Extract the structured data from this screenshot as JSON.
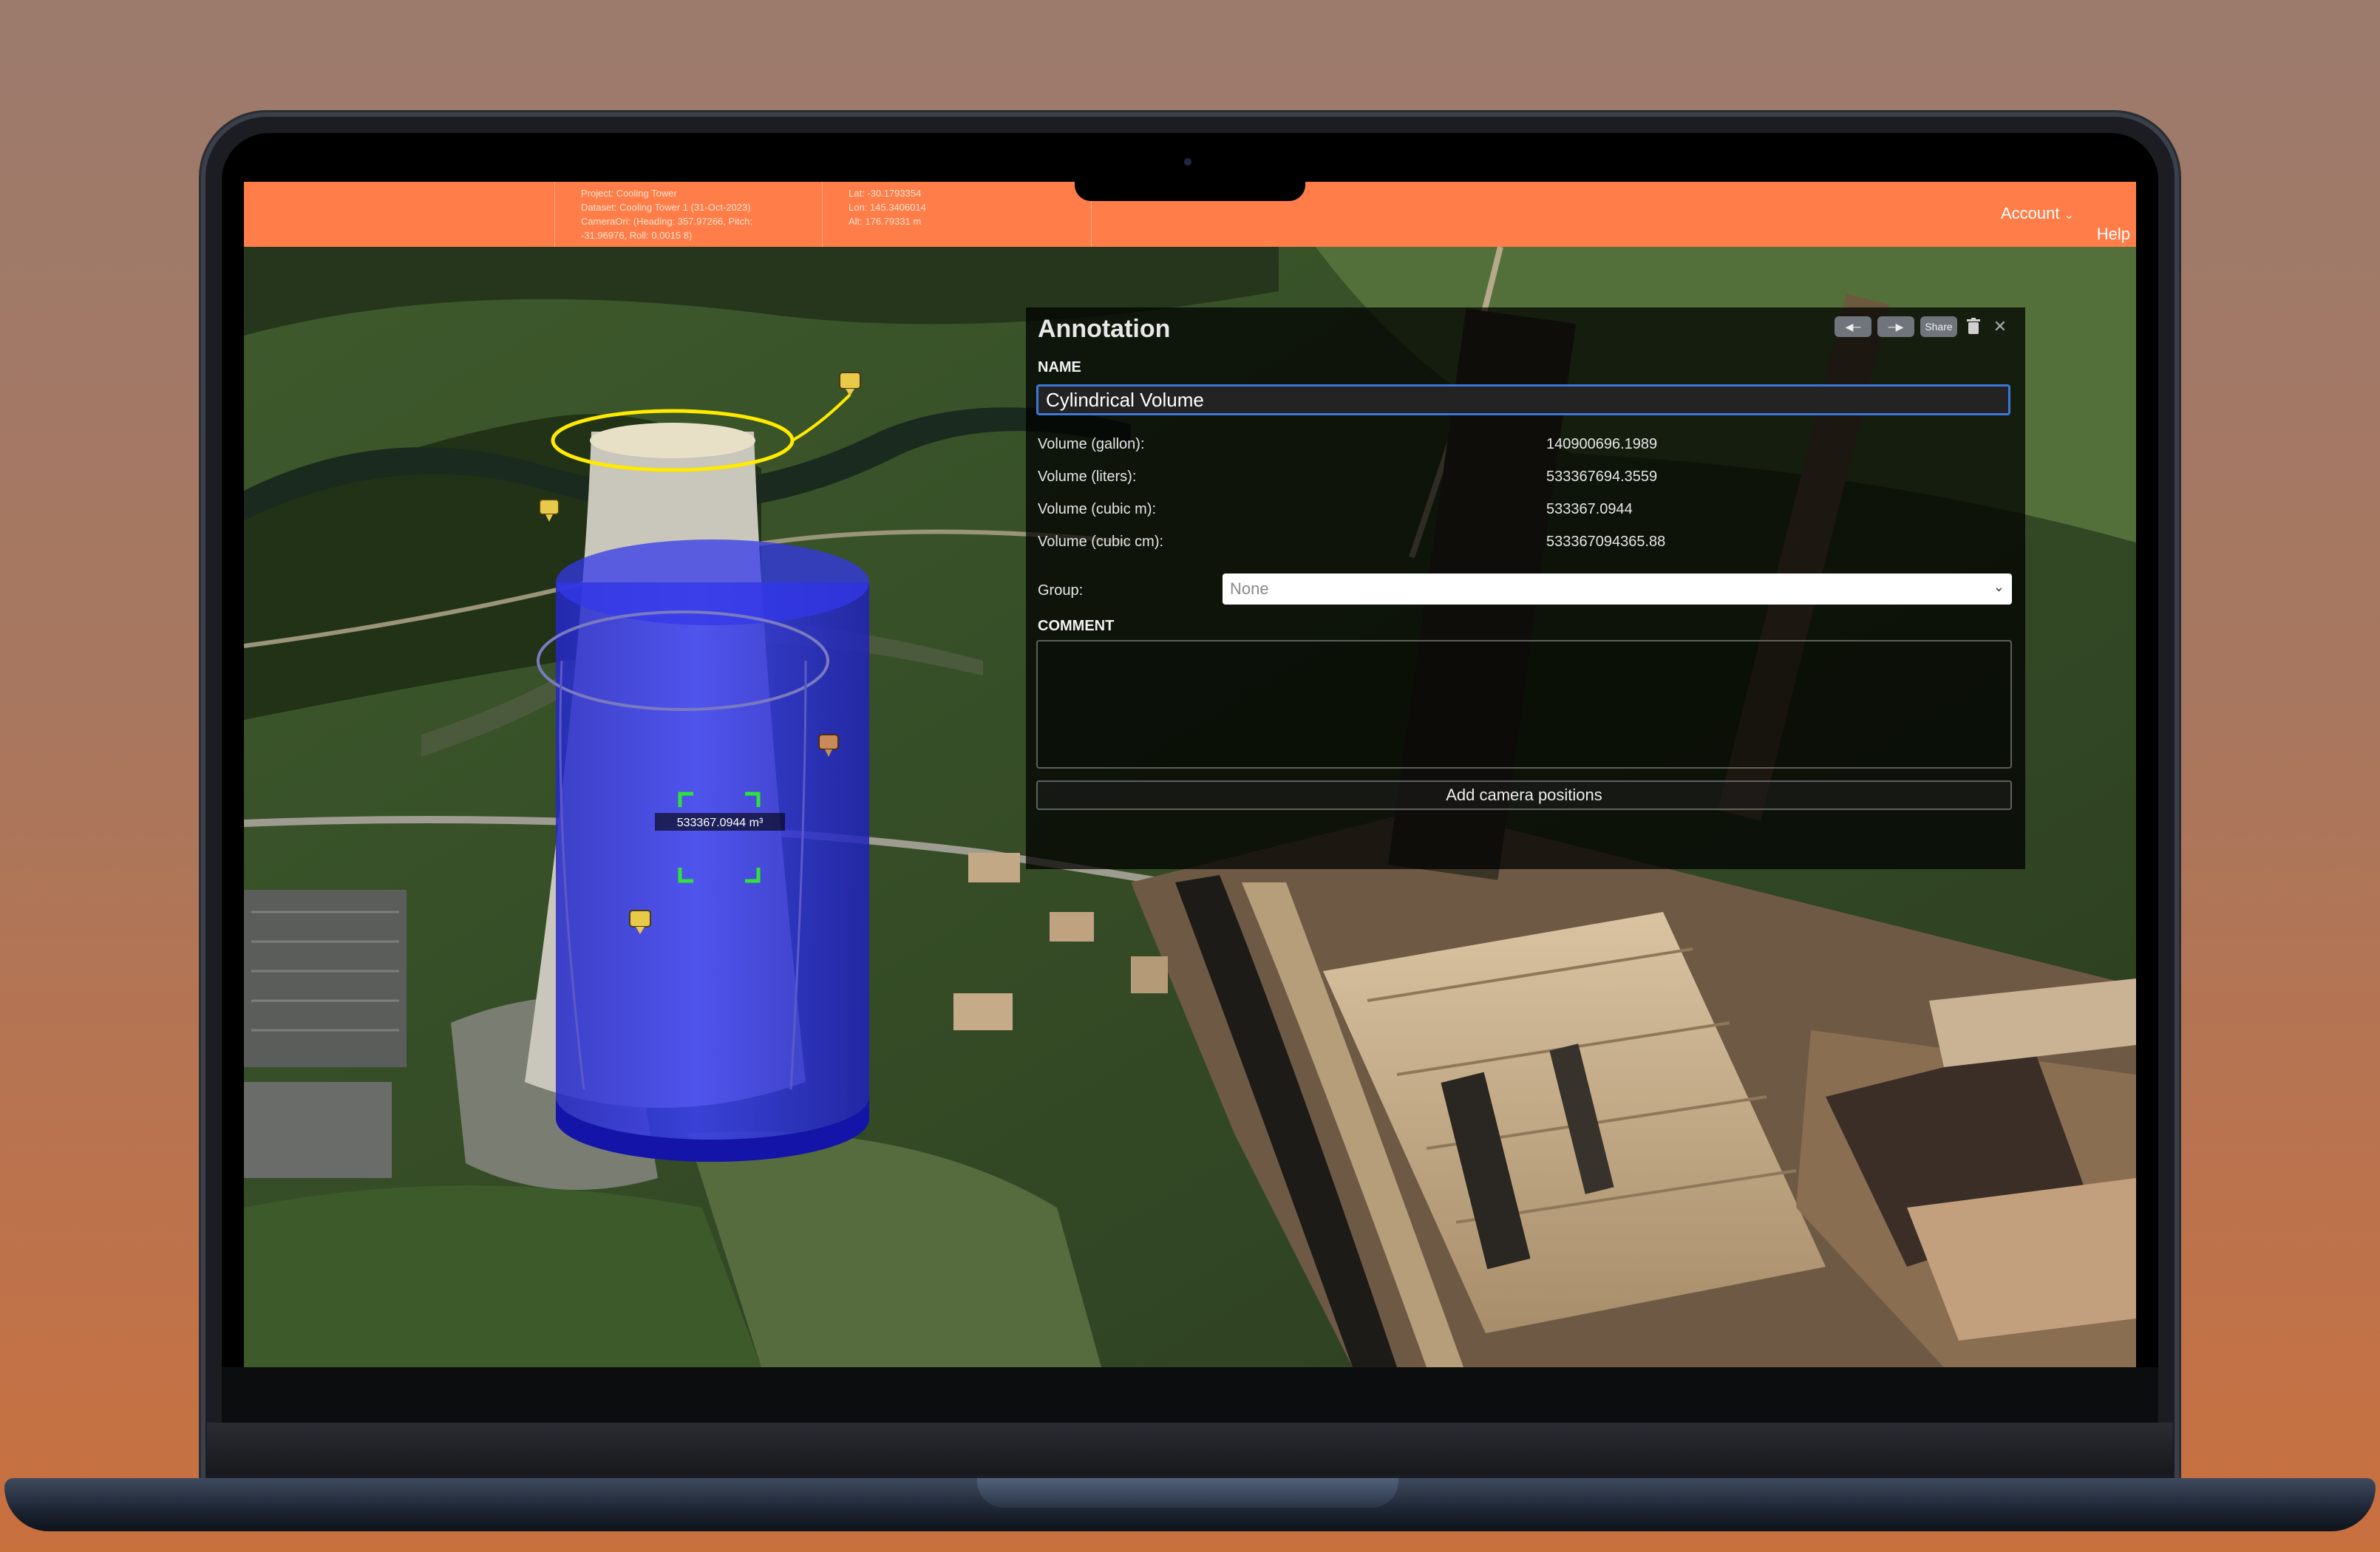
{
  "topbar": {
    "info_left": "Project: Cooling Tower\nDataset: Cooling Tower 1 (31-Oct-2023)\nCameraOri: (Heading: 357.97266, Pitch:\n-31.96976, Roll: 0.0015 8)",
    "info_right": "Lat: -30.1793354\nLon: 145.3406014\nAlt: 176.79331 m",
    "account_label": "Account",
    "help_label": "Help",
    "bar_color": "#ff7d49"
  },
  "annotation": {
    "title": "Annotation",
    "share_label": "Share",
    "name_label": "NAME",
    "name_value": "Cylindrical Volume",
    "volumes": [
      {
        "label": "Volume (gallon):",
        "value": "140900696.1989"
      },
      {
        "label": "Volume (liters):",
        "value": "533367694.3559"
      },
      {
        "label": "Volume (cubic m):",
        "value": "533367.0944"
      },
      {
        "label": "Volume (cubic cm):",
        "value": "533367094365.88"
      }
    ],
    "group_label": "Group:",
    "group_value": "None",
    "comment_label": "COMMENT",
    "comment_value": "",
    "camera_button_label": "Add camera positions"
  },
  "scene": {
    "measure_label": "533367.0944 m³",
    "volume_color": "#2a2ef0",
    "ring_color": "#ffea00",
    "marker_color": "#e9c94a",
    "crosshair_color": "#2ee23a"
  },
  "icons": [
    "prev-icon",
    "next-icon",
    "trash-icon",
    "close-icon",
    "chevron-down-icon",
    "comment-marker-icon"
  ]
}
